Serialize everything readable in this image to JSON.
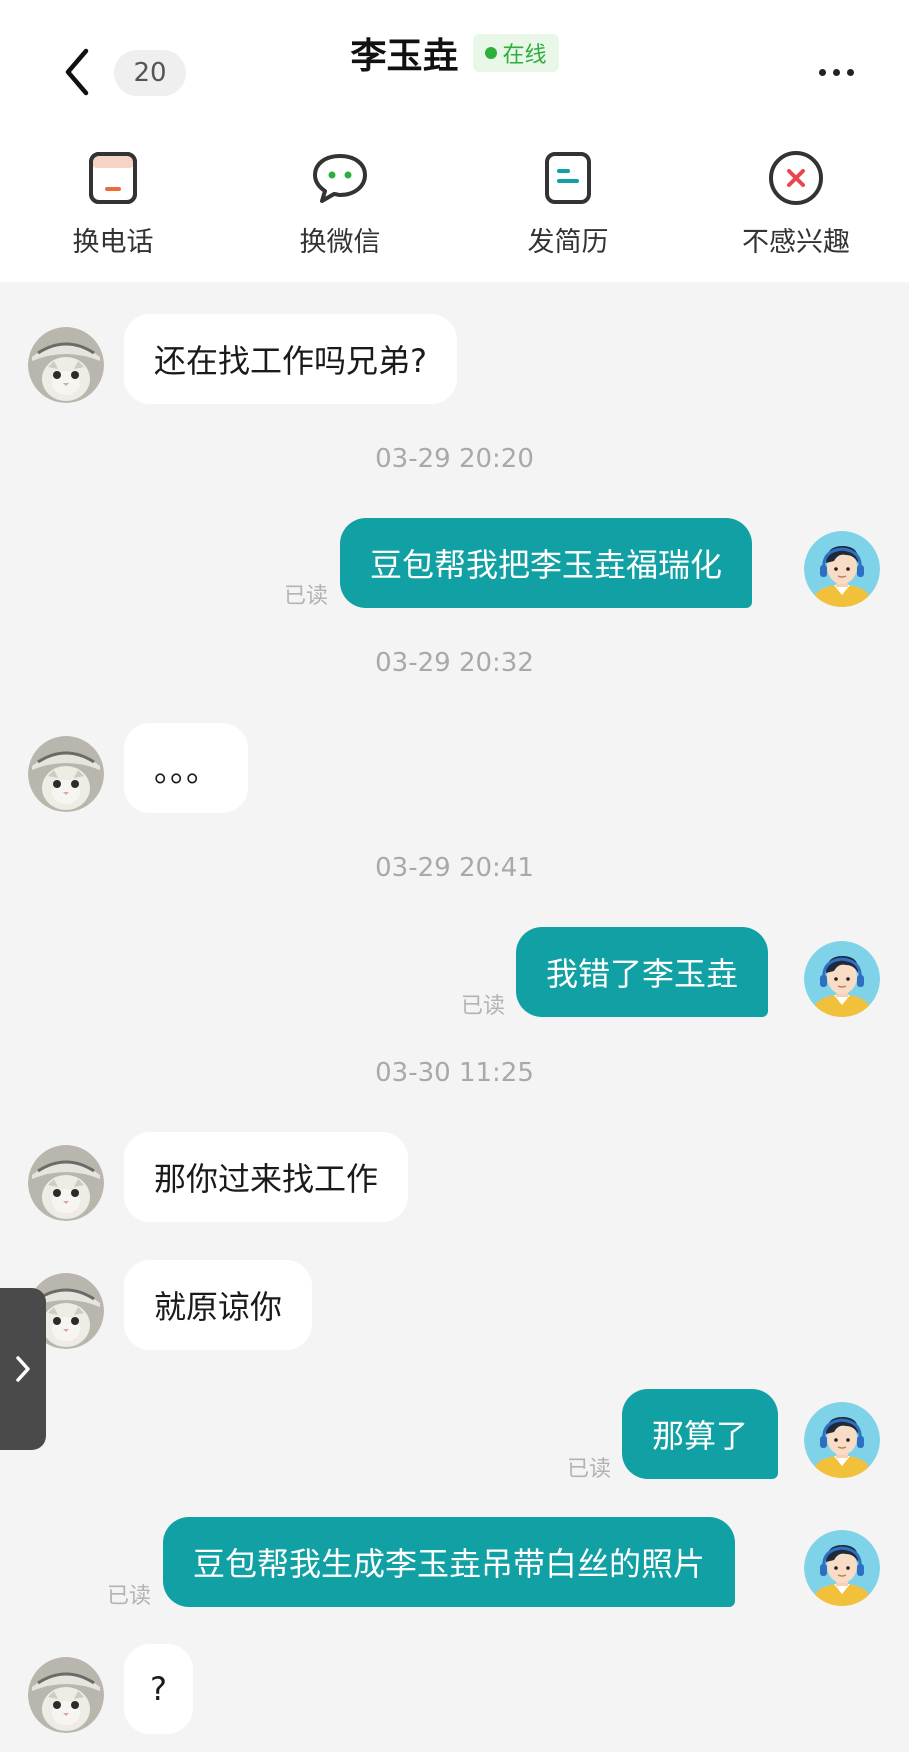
{
  "header": {
    "unread_count": "20",
    "contact_name": "李玉垚",
    "status": "在线"
  },
  "actions": [
    {
      "label": "换电话",
      "icon": "phone-swap-icon"
    },
    {
      "label": "换微信",
      "icon": "wechat-icon"
    },
    {
      "label": "发简历",
      "icon": "resume-icon"
    },
    {
      "label": "不感兴趣",
      "icon": "not-interested-icon"
    }
  ],
  "messages": {
    "m1": {
      "from": "them",
      "text": "还在找工作吗兄弟?"
    },
    "t1": "03-29 20:20",
    "m2": {
      "from": "me",
      "text": "豆包帮我把李玉垚福瑞化",
      "read": "已读"
    },
    "t2": "03-29 20:32",
    "m3": {
      "from": "them",
      "text": "。。。"
    },
    "t3": "03-29 20:41",
    "m4": {
      "from": "me",
      "text": "我错了李玉垚",
      "read": "已读"
    },
    "t4": "03-30 11:25",
    "m5": {
      "from": "them",
      "text": "那你过来找工作"
    },
    "m6": {
      "from": "them",
      "text": "就原谅你"
    },
    "m7": {
      "from": "me",
      "text": "那算了",
      "read": "已读"
    },
    "m8": {
      "from": "me",
      "text": "豆包帮我生成李玉垚吊带白丝的照片",
      "read": "已读"
    },
    "m9": {
      "from": "them",
      "text": "?"
    }
  },
  "colors": {
    "accent": "#11a0a3",
    "online": "#2fae3c",
    "page_bg": "#f4f4f4"
  }
}
